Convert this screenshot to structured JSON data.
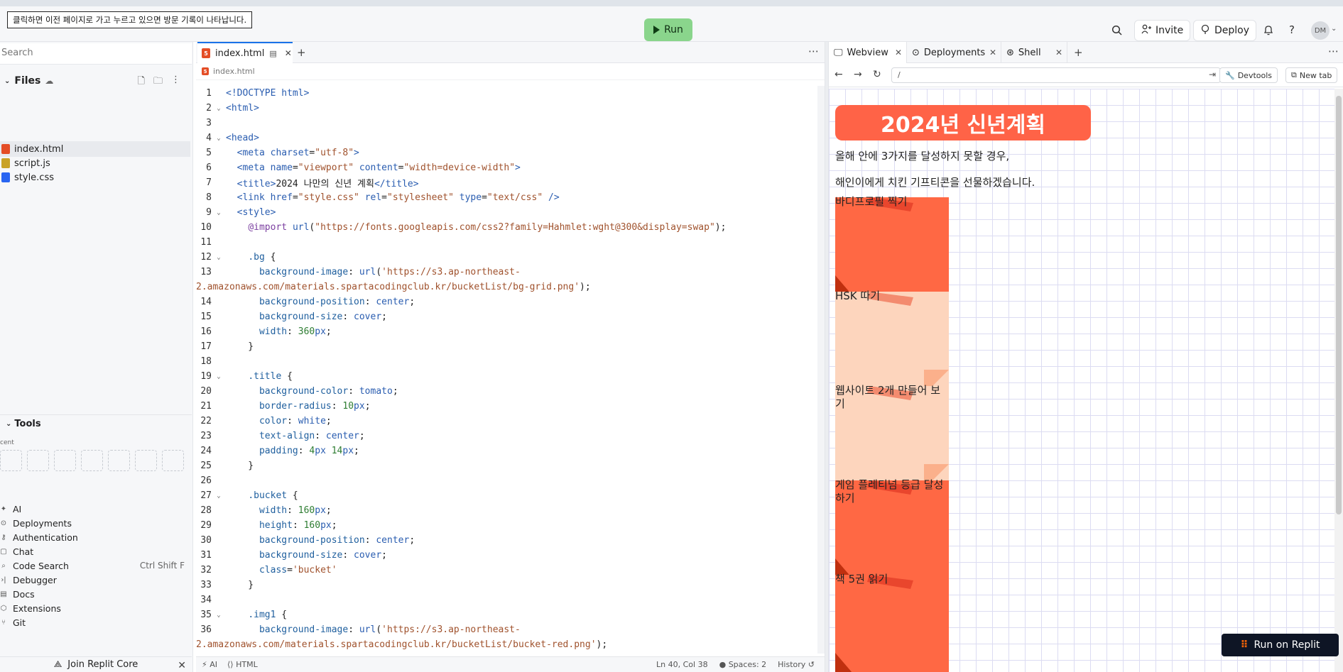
{
  "tooltip": "클릭하면 이전 페이지로 가고 누르고 있으면 방문 기록이 나타납니다.",
  "topbar": {
    "run_label": "Run",
    "invite_label": "Invite",
    "deploy_label": "Deploy",
    "avatar_initials": "DM"
  },
  "sidebar": {
    "search_placeholder": "Search",
    "files_label": "Files",
    "files": [
      {
        "name": "index.html",
        "icon": "html-file-icon",
        "color": "#e44d26"
      },
      {
        "name": "script.js",
        "icon": "js-file-icon",
        "color": "#c9a227"
      },
      {
        "name": "style.css",
        "icon": "css-file-icon",
        "color": "#2965f1"
      }
    ],
    "tools_label": "Tools",
    "recent_label": "Recent",
    "tools": [
      {
        "label": "AI",
        "icon": "ai-icon"
      },
      {
        "label": "Deployments",
        "icon": "deploy-icon"
      },
      {
        "label": "Authentication",
        "icon": "key-icon"
      },
      {
        "label": "Chat",
        "icon": "chat-icon"
      },
      {
        "label": "Code Search",
        "icon": "search-icon",
        "shortcut": "Ctrl Shift F"
      },
      {
        "label": "Debugger",
        "icon": "debugger-icon"
      },
      {
        "label": "Docs",
        "icon": "docs-icon"
      },
      {
        "label": "Extensions",
        "icon": "extensions-icon"
      },
      {
        "label": "Git",
        "icon": "git-icon"
      }
    ],
    "join_core": "Join Replit Core"
  },
  "editor": {
    "tab_label": "index.html",
    "breadcrumb": "index.html",
    "lines": [
      {
        "n": "1",
        "fold": false,
        "html": "<span style=\"color:#2a5db0\">&lt;!DOCTYPE html&gt;</span>"
      },
      {
        "n": "2",
        "fold": true,
        "html": "<span style=\"color:#2a5db0\">&lt;html&gt;</span>"
      },
      {
        "n": "3",
        "fold": false,
        "html": ""
      },
      {
        "n": "4",
        "fold": true,
        "html": "<span style=\"color:#2a5db0\">&lt;head&gt;</span>"
      },
      {
        "n": "5",
        "fold": false,
        "html": "  <span style=\"color:#2a5db0\">&lt;meta</span> <span style=\"color:#2a5db0\">charset</span>=<span style=\"color:#a0522d\">\"utf-8\"</span><span style=\"color:#2a5db0\">&gt;</span>"
      },
      {
        "n": "6",
        "fold": false,
        "html": "  <span style=\"color:#2a5db0\">&lt;meta</span> <span style=\"color:#2a5db0\">name</span>=<span style=\"color:#a0522d\">\"viewport\"</span> <span style=\"color:#2a5db0\">content</span>=<span style=\"color:#a0522d\">\"width=device-width\"</span><span style=\"color:#2a5db0\">&gt;</span>"
      },
      {
        "n": "7",
        "fold": false,
        "html": "  <span style=\"color:#2a5db0\">&lt;title&gt;</span>2024 나만의 신년 계획<span style=\"color:#2a5db0\">&lt;/title&gt;</span>"
      },
      {
        "n": "8",
        "fold": false,
        "html": "  <span style=\"color:#2a5db0\">&lt;link</span> <span style=\"color:#2a5db0\">href</span>=<span style=\"color:#a0522d\">\"style.css\"</span> <span style=\"color:#2a5db0\">rel</span>=<span style=\"color:#a0522d\">\"stylesheet\"</span> <span style=\"color:#2a5db0\">type</span>=<span style=\"color:#a0522d\">\"text/css\"</span> <span style=\"color:#2a5db0\">/&gt;</span>"
      },
      {
        "n": "9",
        "fold": true,
        "html": "  <span style=\"color:#2a5db0\">&lt;style&gt;</span>"
      },
      {
        "n": "10",
        "fold": false,
        "html": "    <span style=\"color:#7b3fa0\">@import</span> <span style=\"color:#2a5db0\">url</span>(<span style=\"color:#a0522d\">\"https://fonts.googleapis.com/css2?family=Hahmlet:wght@300&amp;display=swap\"</span>);"
      },
      {
        "n": "11",
        "fold": false,
        "html": ""
      },
      {
        "n": "12",
        "fold": true,
        "html": "    <span style=\"color:#1f5f9e\">.bg</span> {"
      },
      {
        "n": "13",
        "fold": false,
        "html": "      <span style=\"color:#1f5f9e\">background-image</span>: <span style=\"color:#2a5db0\">url</span>(<span style=\"color:#a0522d\">'https://s3.ap-northeast-</span>"
      },
      {
        "n": "",
        "fold": false,
        "wrap": true,
        "html": "<span style=\"color:#a0522d\">2.amazonaws.com/materials.spartacodingclub.kr/bucketList/bg-grid.png'</span>);"
      },
      {
        "n": "14",
        "fold": false,
        "html": "      <span style=\"color:#1f5f9e\">background-position</span>: <span style=\"color:#2a5db0\">center</span>;"
      },
      {
        "n": "15",
        "fold": false,
        "html": "      <span style=\"color:#1f5f9e\">background-size</span>: <span style=\"color:#2a5db0\">cover</span>;"
      },
      {
        "n": "16",
        "fold": false,
        "html": "      <span style=\"color:#1f5f9e\">width</span>: <span style=\"color:#2e7d32\">360</span><span style=\"color:#2a5db0\">px</span>;"
      },
      {
        "n": "17",
        "fold": false,
        "html": "    }"
      },
      {
        "n": "18",
        "fold": false,
        "html": ""
      },
      {
        "n": "19",
        "fold": true,
        "html": "    <span style=\"color:#1f5f9e\">.title</span> {"
      },
      {
        "n": "20",
        "fold": false,
        "html": "      <span style=\"color:#1f5f9e\">background-color</span>: <span style=\"color:#2a5db0\">tomato</span>;"
      },
      {
        "n": "21",
        "fold": false,
        "html": "      <span style=\"color:#1f5f9e\">border-radius</span>: <span style=\"color:#2e7d32\">10</span><span style=\"color:#2a5db0\">px</span>;"
      },
      {
        "n": "22",
        "fold": false,
        "html": "      <span style=\"color:#1f5f9e\">color</span>: <span style=\"color:#2a5db0\">white</span>;"
      },
      {
        "n": "23",
        "fold": false,
        "html": "      <span style=\"color:#1f5f9e\">text-align</span>: <span style=\"color:#2a5db0\">center</span>;"
      },
      {
        "n": "24",
        "fold": false,
        "html": "      <span style=\"color:#1f5f9e\">padding</span>: <span style=\"color:#2e7d32\">4</span><span style=\"color:#2a5db0\">px</span> <span style=\"color:#2e7d32\">14</span><span style=\"color:#2a5db0\">px</span>;"
      },
      {
        "n": "25",
        "fold": false,
        "html": "    }"
      },
      {
        "n": "26",
        "fold": false,
        "html": ""
      },
      {
        "n": "27",
        "fold": true,
        "html": "    <span style=\"color:#1f5f9e\">.bucket</span> {"
      },
      {
        "n": "28",
        "fold": false,
        "html": "      <span style=\"color:#1f5f9e\">width</span>: <span style=\"color:#2e7d32\">160</span><span style=\"color:#2a5db0\">px</span>;"
      },
      {
        "n": "29",
        "fold": false,
        "html": "      <span style=\"color:#1f5f9e\">height</span>: <span style=\"color:#2e7d32\">160</span><span style=\"color:#2a5db0\">px</span>;"
      },
      {
        "n": "30",
        "fold": false,
        "html": "      <span style=\"color:#1f5f9e\">background-position</span>: <span style=\"color:#2a5db0\">center</span>;"
      },
      {
        "n": "31",
        "fold": false,
        "html": "      <span style=\"color:#1f5f9e\">background-size</span>: <span style=\"color:#2a5db0\">cover</span>;"
      },
      {
        "n": "32",
        "fold": false,
        "html": "      <span style=\"color:#1f5f9e\">class</span>=<span style=\"color:#a0522d\">'bucket'</span>"
      },
      {
        "n": "33",
        "fold": false,
        "html": "    }"
      },
      {
        "n": "34",
        "fold": false,
        "html": ""
      },
      {
        "n": "35",
        "fold": true,
        "html": "    <span style=\"color:#1f5f9e\">.img1</span> {"
      },
      {
        "n": "36",
        "fold": false,
        "html": "      <span style=\"color:#1f5f9e\">background-image</span>: <span style=\"color:#2a5db0\">url</span>(<span style=\"color:#a0522d\">'https://s3.ap-northeast-</span>"
      },
      {
        "n": "",
        "fold": false,
        "wrap": true,
        "html": "<span style=\"color:#a0522d\">2.amazonaws.com/materials.spartacodingclub.kr/bucketList/bucket-red.png'</span>);"
      }
    ],
    "status": {
      "ai": "AI",
      "lang": "HTML",
      "cursor": "Ln 40, Col 38",
      "spaces": "Spaces: 2",
      "history": "History"
    }
  },
  "preview": {
    "tabs": [
      "Webview",
      "Deployments",
      "Shell"
    ],
    "url": "/",
    "devtools_label": "Devtools",
    "newtab_label": "New tab",
    "page_title": "2024년 신년계획",
    "intro_1": "올해 안에 3가지를 달성하지 못할 경우,",
    "intro_2": "해인이에게 치킨 기프티콘을 선물하겠습니다.",
    "buckets": [
      {
        "label": "바디프로필 찍기",
        "variant": "red"
      },
      {
        "label": "HSK 따기",
        "variant": "peach"
      },
      {
        "label": "웹사이트 2개 만들어 보기",
        "variant": "peach"
      },
      {
        "label": "게임 플레티넘 등급 달성하기",
        "variant": "red"
      },
      {
        "label": "책 5권 읽기",
        "variant": "red"
      }
    ],
    "colors": {
      "red": "#ff6844",
      "red_tape": "#e8452c",
      "red_fold": "#c0300f",
      "peach": "#fdd5bd",
      "peach_tape": "#f2876a",
      "peach_fold": "#fbb08b"
    }
  },
  "run_on_replit": "Run on Replit"
}
